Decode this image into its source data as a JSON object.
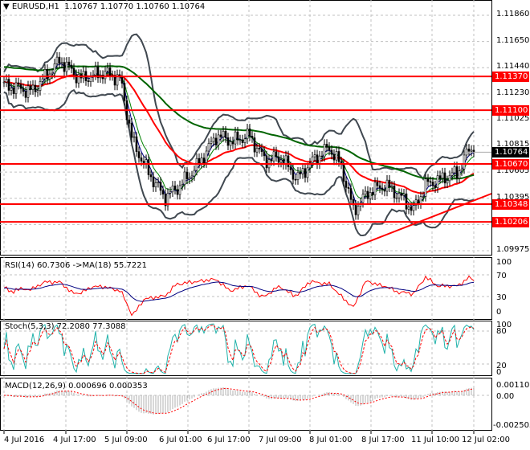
{
  "header": {
    "symbol": "EURUSD,H1",
    "open": "1.10767",
    "high": "1.10770",
    "low": "1.10760",
    "close": "1.10764"
  },
  "price_axis": [
    "1.11860",
    "1.11650",
    "1.11440",
    "1.11230",
    "1.11025",
    "1.10815",
    "1.10605",
    "1.10395",
    "1.10185",
    "1.09975"
  ],
  "levels": [
    {
      "label": "1.11370",
      "value": 1.1137
    },
    {
      "label": "1.11100",
      "value": 1.111
    },
    {
      "label": "1.10670",
      "value": 1.1067
    },
    {
      "label": "1.10348",
      "value": 1.10348
    },
    {
      "label": "1.10206",
      "value": 1.10206
    }
  ],
  "current_price": {
    "label": "1.10764",
    "value": 1.10764
  },
  "rsi": {
    "label": "RSI(14) 60.7306  ->MA(18) 55.7221",
    "axis": [
      "100",
      "70",
      "30",
      "0"
    ]
  },
  "stoch": {
    "label": "Stoch(5,3,3) 72.2080 77.3088",
    "axis": [
      "100",
      "80",
      "20",
      "0"
    ]
  },
  "macd": {
    "label": "MACD(12,26,9) 0.000696 0.000353",
    "axis": [
      "0.001105",
      "0.00",
      "-0.002505"
    ]
  },
  "time_axis": [
    "4 Jul 2016",
    "4 Jul 17:00",
    "5 Jul 09:00",
    "6 Jul 01:00",
    "6 Jul 17:00",
    "7 Jul 09:00",
    "8 Jul 01:00",
    "8 Jul 17:00",
    "11 Jul 10:00",
    "12 Jul 02:00"
  ],
  "colors": {
    "level": "#ff0000",
    "ma_fast": "#ff0000",
    "ma_slow": "#006400",
    "bands": "#404850",
    "rsi": "#ff0000",
    "rsi_ma": "#000080",
    "stoch_main": "#20b2aa",
    "stoch_signal": "#ff0000"
  },
  "chart_data": {
    "type": "line",
    "title": "EURUSD,H1",
    "x": [
      5,
      40,
      75,
      100,
      130,
      150,
      165,
      185,
      205,
      225,
      245,
      270,
      290,
      310,
      330,
      350,
      370,
      390,
      410,
      425,
      440,
      460,
      480,
      500,
      515,
      530,
      550,
      570,
      585,
      592
    ],
    "close": [
      1.113,
      1.1125,
      1.115,
      1.1135,
      1.114,
      1.1135,
      1.1085,
      1.106,
      1.104,
      1.105,
      1.1065,
      1.109,
      1.1085,
      1.109,
      1.107,
      1.1072,
      1.1055,
      1.107,
      1.108,
      1.1065,
      1.103,
      1.1045,
      1.105,
      1.104,
      1.103,
      1.105,
      1.1055,
      1.106,
      1.108,
      1.10764
    ],
    "ylim": [
      1.09975,
      1.1186
    ]
  }
}
